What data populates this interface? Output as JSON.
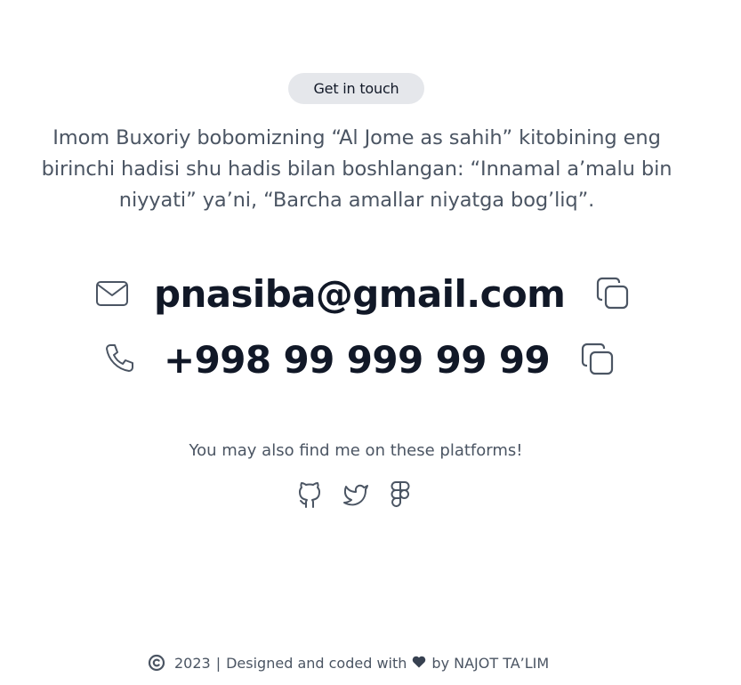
{
  "badge": {
    "label": "Get in touch"
  },
  "intro": {
    "text": "Imom Buxoriy bobomizning “Al Jome as sahih” kitobining eng birinchi hadisi shu hadis bilan boshlangan: “Innamal a’malu bin niyyati” ya’ni, “Barcha amallar niyatga bog’liq”."
  },
  "contact": {
    "email": {
      "icon": "mail-icon",
      "value": "pnasiba@gmail.com",
      "copy_icon": "copy-icon"
    },
    "phone": {
      "icon": "phone-icon",
      "value": "+998 99 999 99 99",
      "copy_icon": "copy-icon"
    }
  },
  "platforms": {
    "label": "You may also find me on these platforms!",
    "items": [
      {
        "name": "github-icon"
      },
      {
        "name": "twitter-icon"
      },
      {
        "name": "figma-icon"
      }
    ]
  },
  "footer": {
    "copyright_icon": "copyright-icon",
    "year": "2023",
    "designed_text": "Designed and coded with",
    "heart_icon": "heart-icon",
    "by_text": "by NAJOT TA’LIM"
  },
  "colors": {
    "text_dark": "#111827",
    "text_muted": "#4b5563",
    "badge_bg": "#e5e7eb"
  }
}
